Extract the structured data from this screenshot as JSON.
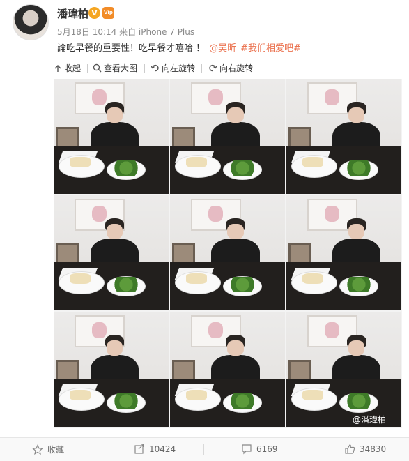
{
  "post": {
    "username": "潘瑋柏",
    "verified_badge": "V",
    "vip_badge": "Vip",
    "meta": "5月18日 10:14 来自 iPhone 7 Plus",
    "text": "論吃早餐的重要性！吃早餐才嘻哈 ！",
    "links": [
      "@吴昕",
      "#我们相爱吧#"
    ]
  },
  "toolbar": {
    "collapse": "收起",
    "view_large": "查看大图",
    "rotate_left": "向左旋转",
    "rotate_right": "向右旋转"
  },
  "image": {
    "watermark": "@潘瑋柏",
    "grid": "3x3"
  },
  "actions": {
    "favorite": "收藏",
    "reposts": "10424",
    "comments": "6169",
    "likes": "34830"
  },
  "colors": {
    "link": "#eb7350",
    "verified": "#f5a623",
    "text": "#333333",
    "meta": "#8a8a8a"
  }
}
